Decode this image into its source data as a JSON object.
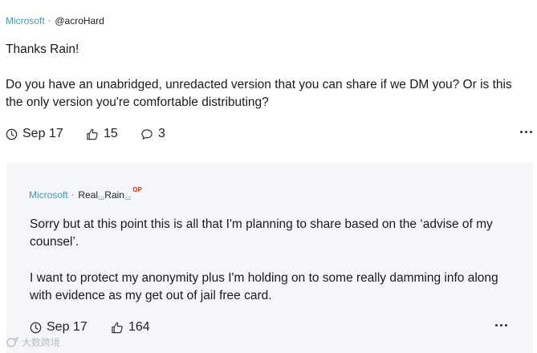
{
  "post": {
    "company": "Microsoft",
    "separator": "·",
    "handle": "@acroHard",
    "paragraphs": [
      "Thanks Rain!",
      "Do you have an unabridged, unredacted version that you can share if we DM you? Or is this the only version you're comfortable distributing?"
    ],
    "date": "Sep 17",
    "likes": "15",
    "comments": "3",
    "icons": {
      "date": "clock-icon",
      "like": "thumbs-up-icon",
      "comment": "comment-bubble-icon",
      "more": "more-options-icon"
    }
  },
  "reply": {
    "company": "Microsoft",
    "separator": "·",
    "handle_part1": "Real",
    "handle_part2": "Rain",
    "handle_deco": "ꟺ",
    "op_badge": "OP",
    "paragraphs": [
      "Sorry but at this point this is all that I'm planning to share based on the ‘advise of my counsel’.",
      "I want to protect my anonymity plus I'm holding on to some really damming info along with evidence as my get out of jail free card."
    ],
    "date": "Sep 17",
    "likes": "164",
    "icons": {
      "date": "clock-icon",
      "like": "thumbs-up-icon",
      "more": "more-options-icon"
    }
  },
  "watermark": {
    "text": "大数跨境"
  },
  "colors": {
    "company": "#3f9bb0",
    "op_badge": "#d4351c",
    "reply_bg": "#f4f6f9"
  }
}
